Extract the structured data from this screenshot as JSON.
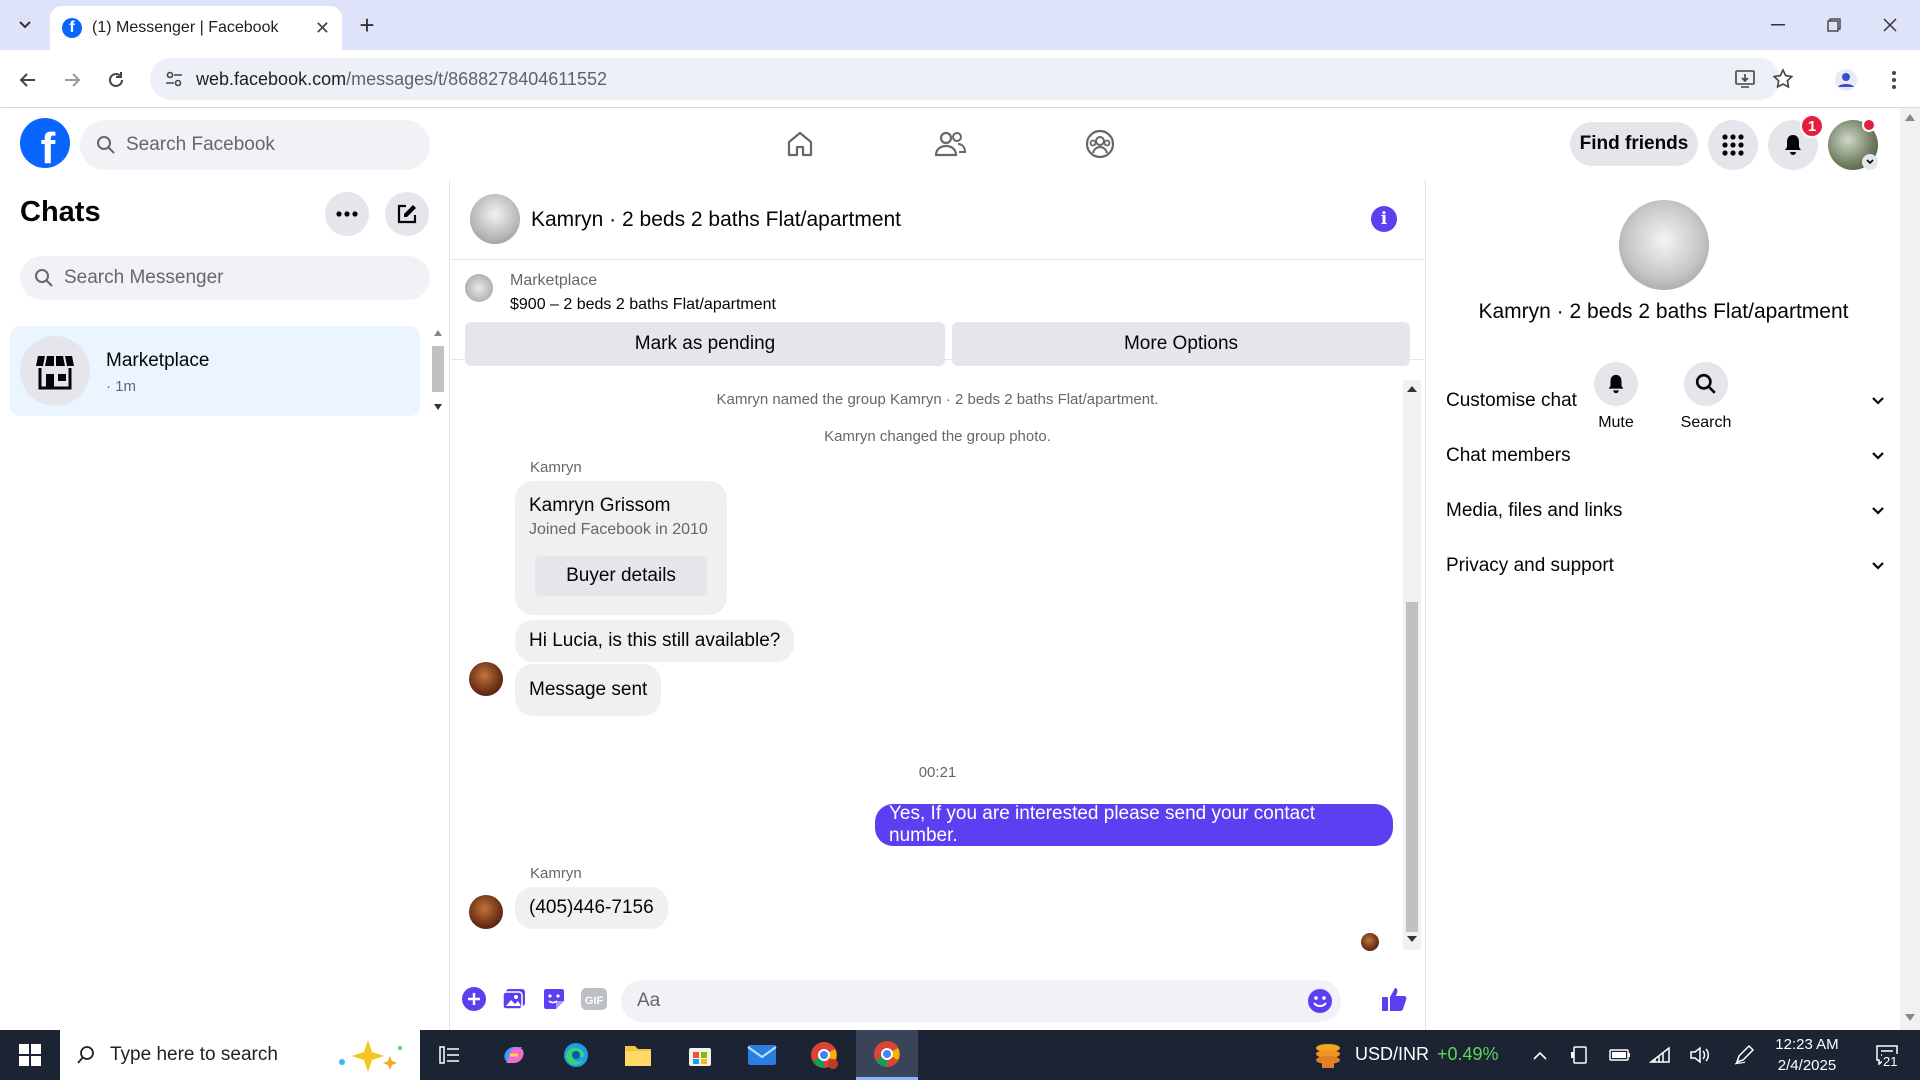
{
  "browser": {
    "tab_title": "(1) Messenger | Facebook",
    "url_host": "web.facebook.com",
    "url_path": "/messages/t/8688278404611552"
  },
  "fb_header": {
    "search_placeholder": "Search Facebook",
    "find_friends": "Find friends",
    "notification_count": "1"
  },
  "chats": {
    "title": "Chats",
    "search_placeholder": "Search Messenger",
    "items": [
      {
        "name": "Marketplace",
        "time": "· 1m"
      }
    ]
  },
  "conversation": {
    "title": "Kamryn · 2 beds 2 baths Flat/apartment",
    "marketplace_label": "Marketplace",
    "listing": "$900 – 2 beds 2 baths Flat/apartment",
    "mark_pending": "Mark as pending",
    "more_options": "More Options",
    "system_messages": [
      "Kamryn named the group Kamryn · 2 beds 2 baths Flat/apartment.",
      "Kamryn changed the group photo."
    ],
    "sender_name": "Kamryn",
    "profile_card": {
      "name": "Kamryn Grissom",
      "joined": "Joined Facebook in 2010",
      "button": "Buyer details"
    },
    "incoming_1": "Hi Lucia, is this still available?",
    "incoming_2": "Message sent",
    "timestamp": "00:21",
    "outgoing_1": "Yes, If you are interested please send your contact number.",
    "sender_name_2": "Kamryn",
    "incoming_3": "(405)446-7156",
    "composer_placeholder": "Aa"
  },
  "info_panel": {
    "title": "Kamryn · 2 beds 2 baths Flat/apartment",
    "mute": "Mute",
    "search": "Search",
    "sections": [
      "Customise chat",
      "Chat members",
      "Media, files and links",
      "Privacy and support"
    ]
  },
  "taskbar": {
    "search_placeholder": "Type here to search",
    "ticker_label": "USD/INR",
    "ticker_change": "+0.49%",
    "time": "12:23 AM",
    "date": "2/4/2025",
    "notif_count": "21"
  },
  "colors": {
    "accent": "#5b3ff0",
    "fb_blue": "#0866ff",
    "badge_red": "#e41e3f",
    "selected_chat_bg": "#ebf5ff"
  }
}
